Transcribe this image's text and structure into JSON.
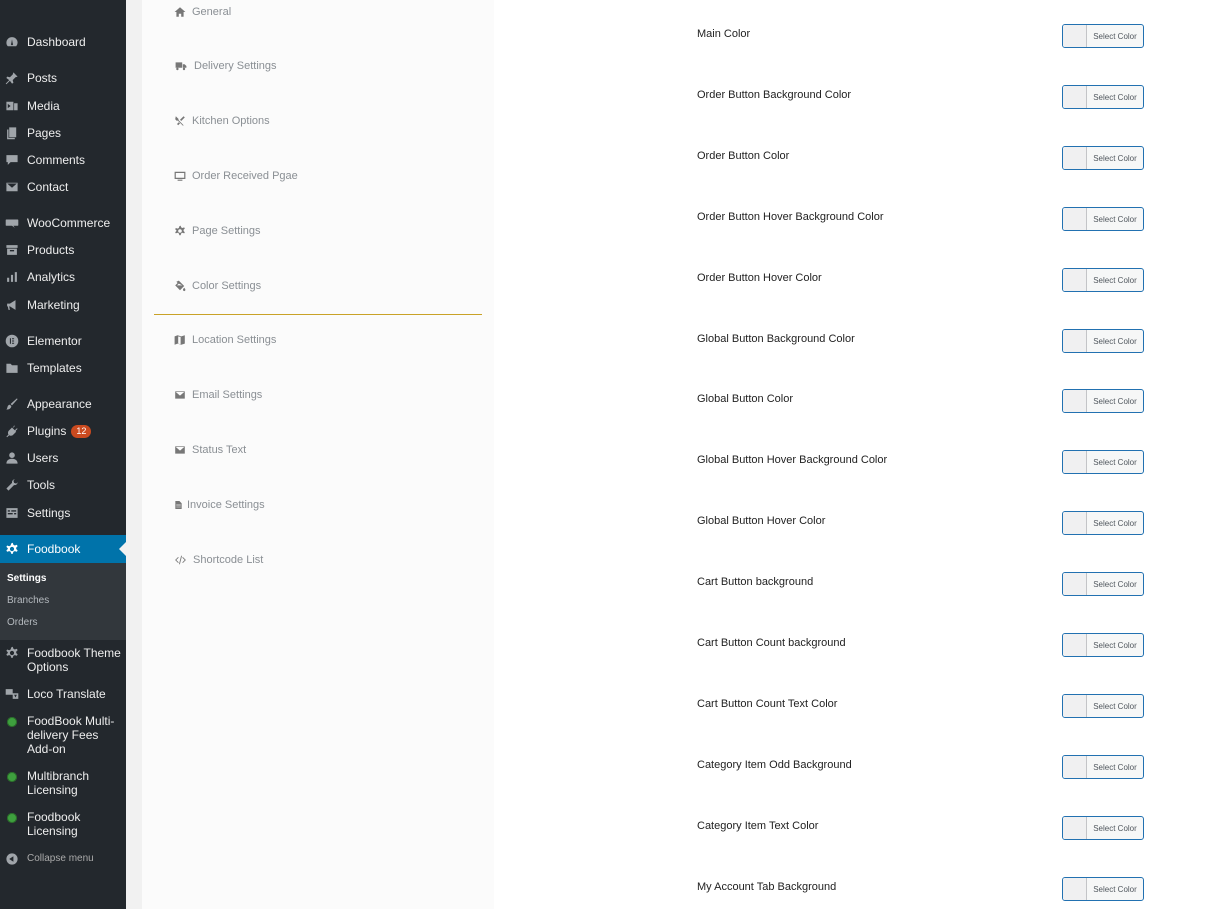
{
  "sidebar": {
    "items": [
      {
        "label": "Dashboard",
        "icon": "dashboard-icon"
      },
      {
        "label": "Posts",
        "icon": "pin-icon"
      },
      {
        "label": "Media",
        "icon": "media-icon"
      },
      {
        "label": "Pages",
        "icon": "pages-icon"
      },
      {
        "label": "Comments",
        "icon": "comment-icon"
      },
      {
        "label": "Contact",
        "icon": "envelope-icon"
      },
      {
        "label": "WooCommerce",
        "icon": "woo-icon"
      },
      {
        "label": "Products",
        "icon": "archive-icon"
      },
      {
        "label": "Analytics",
        "icon": "bar-chart-icon"
      },
      {
        "label": "Marketing",
        "icon": "megaphone-icon"
      },
      {
        "label": "Elementor",
        "icon": "elementor-icon"
      },
      {
        "label": "Templates",
        "icon": "folder-icon"
      },
      {
        "label": "Appearance",
        "icon": "brush-icon"
      },
      {
        "label": "Plugins",
        "icon": "plug-icon",
        "badge": "12"
      },
      {
        "label": "Users",
        "icon": "user-icon"
      },
      {
        "label": "Tools",
        "icon": "wrench-icon"
      },
      {
        "label": "Settings",
        "icon": "settings-icon"
      },
      {
        "label": "Foodbook",
        "icon": "gear-icon"
      },
      {
        "label": "Foodbook Theme Options",
        "icon": "gear-icon"
      },
      {
        "label": "Loco Translate",
        "icon": "translate-icon"
      },
      {
        "label": "FoodBook Multi-delivery Fees Add-on",
        "icon": "green-dot-icon"
      },
      {
        "label": "Multibranch Licensing",
        "icon": "green-dot-icon"
      },
      {
        "label": "Foodbook Licensing",
        "icon": "green-dot-icon"
      }
    ],
    "submenu": [
      "Settings",
      "Branches",
      "Orders"
    ],
    "collapse_label": "Collapse menu"
  },
  "settings_nav": {
    "items": [
      {
        "label": "General",
        "icon": "home-icon"
      },
      {
        "label": "Delivery Settings",
        "icon": "truck-icon"
      },
      {
        "label": "Kitchen Options",
        "icon": "utensils-icon"
      },
      {
        "label": "Order Received Pgae",
        "icon": "monitor-icon"
      },
      {
        "label": "Page Settings",
        "icon": "gear-icon"
      },
      {
        "label": "Color Settings",
        "icon": "paint-bucket-icon"
      },
      {
        "label": "Location Settings",
        "icon": "map-icon"
      },
      {
        "label": "Email Settings",
        "icon": "envelope-icon"
      },
      {
        "label": "Status Text",
        "icon": "envelope-icon"
      },
      {
        "label": "Invoice Settings",
        "icon": "file-icon"
      },
      {
        "label": "Shortcode List",
        "icon": "code-icon"
      }
    ],
    "active_index": 5,
    "active_color": "#c9a227"
  },
  "color_settings": {
    "button_label": "Select Color",
    "rows": [
      "Main Color",
      "Order Button Background Color",
      "Order Button Color",
      "Order Button Hover Background Color",
      "Order Button Hover Color",
      "Global Button Background Color",
      "Global Button Color",
      "Global Button Hover Background Color",
      "Global Button Hover Color",
      "Cart Button background",
      "Cart Button Count background",
      "Cart Button Count Text Color",
      "Category Item Odd Background",
      "Category Item Text Color",
      "My Account Tab Background"
    ]
  },
  "colors": {
    "sidebar_bg": "#23282d",
    "current_menu_bg": "#0073aa",
    "badge_bg": "#ca4a1f",
    "button_border": "#2271b1"
  }
}
